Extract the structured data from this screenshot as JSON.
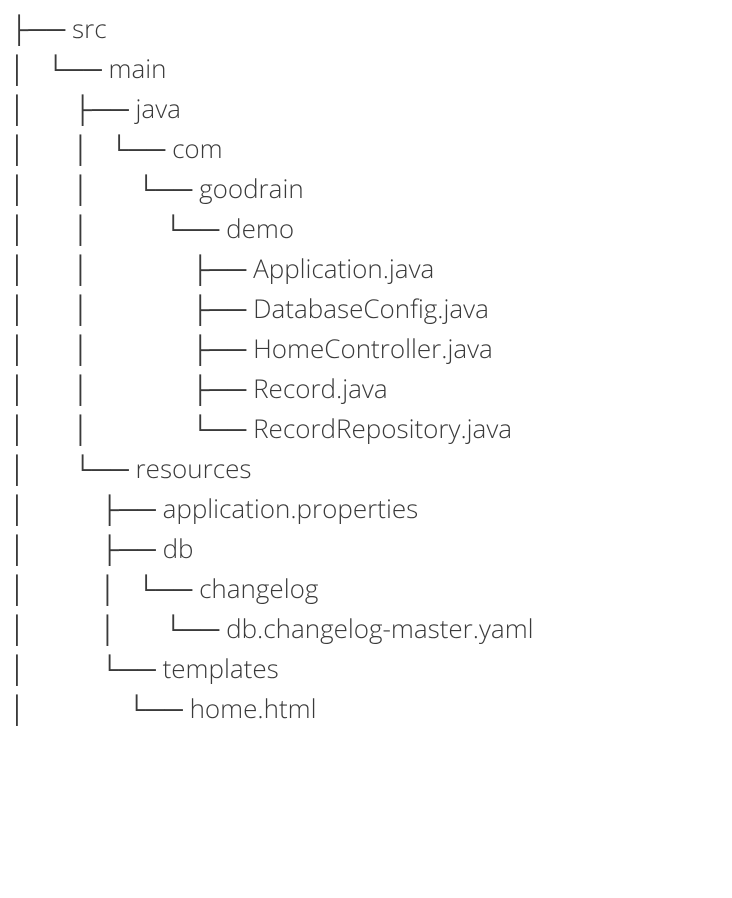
{
  "tree": {
    "lines": [
      {
        "prefix": "├── ",
        "label": "src"
      },
      {
        "prefix": "│   └── ",
        "label": "main"
      },
      {
        "prefix": "│       ├── ",
        "label": "java"
      },
      {
        "prefix": "│       │   └── ",
        "label": "com"
      },
      {
        "prefix": "│       │       └── ",
        "label": "goodrain"
      },
      {
        "prefix": "│       │           └── ",
        "label": "demo"
      },
      {
        "prefix": "│       │               ├── ",
        "label": "Application.java"
      },
      {
        "prefix": "│       │               ├── ",
        "label": "DatabaseConfig.java"
      },
      {
        "prefix": "│       │               ├── ",
        "label": "HomeController.java"
      },
      {
        "prefix": "│       │               ├── ",
        "label": "Record.java"
      },
      {
        "prefix": "│       │               └── ",
        "label": "RecordRepository.java"
      },
      {
        "prefix": "│       └── ",
        "label": "resources"
      },
      {
        "prefix": "│           ├── ",
        "label": "application.properties"
      },
      {
        "prefix": "│           ├── ",
        "label": "db"
      },
      {
        "prefix": "│           │   └── ",
        "label": "changelog"
      },
      {
        "prefix": "│           │       └── ",
        "label": "db.changelog-master.yaml"
      },
      {
        "prefix": "│           └── ",
        "label": "templates"
      },
      {
        "prefix": "│               └── ",
        "label": "home.html"
      }
    ]
  }
}
